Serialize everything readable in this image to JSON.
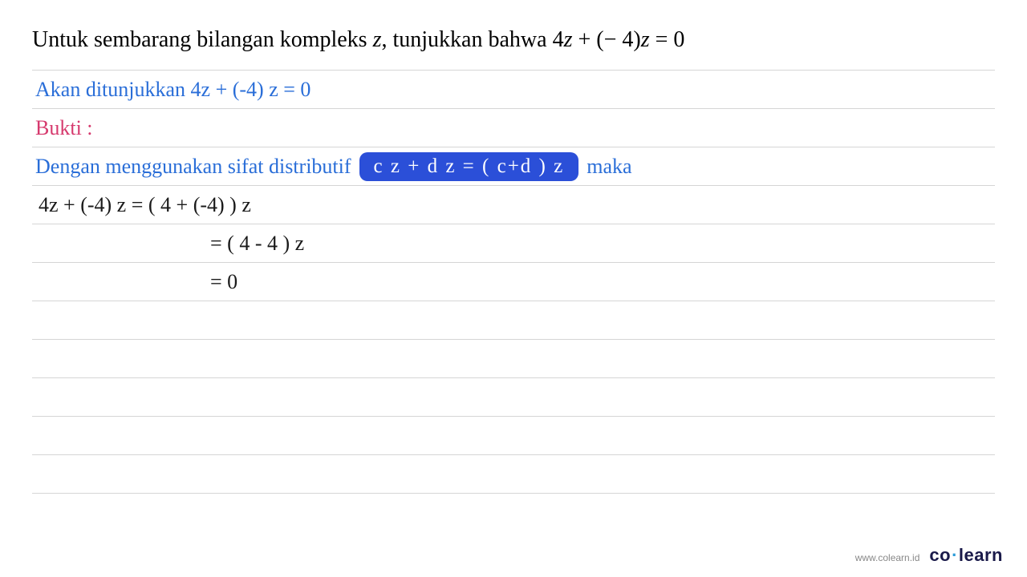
{
  "question": {
    "text_before": "Untuk sembarang bilangan kompleks ",
    "var1": "z",
    "text_mid": ", tunjukkan bahwa  4",
    "var2": "z",
    "text_mid2": " + (− 4)",
    "var3": "z",
    "text_after": " = 0"
  },
  "proof": {
    "line1": "Akan ditunjukkan  4z + (-4) z = 0",
    "line2": "Bukti :",
    "line3_before": "Dengan menggunakan sifat distributif",
    "line3_box": "c z + d z = ( c+d ) z",
    "line3_after": "maka",
    "line4": "4z + (-4) z = ( 4 + (-4) ) z",
    "line5": "= ( 4 - 4 ) z",
    "line6": "= 0"
  },
  "footer": {
    "url": "www.colearn.id",
    "logo_co": "co",
    "logo_dot": "·",
    "logo_learn": "learn"
  }
}
